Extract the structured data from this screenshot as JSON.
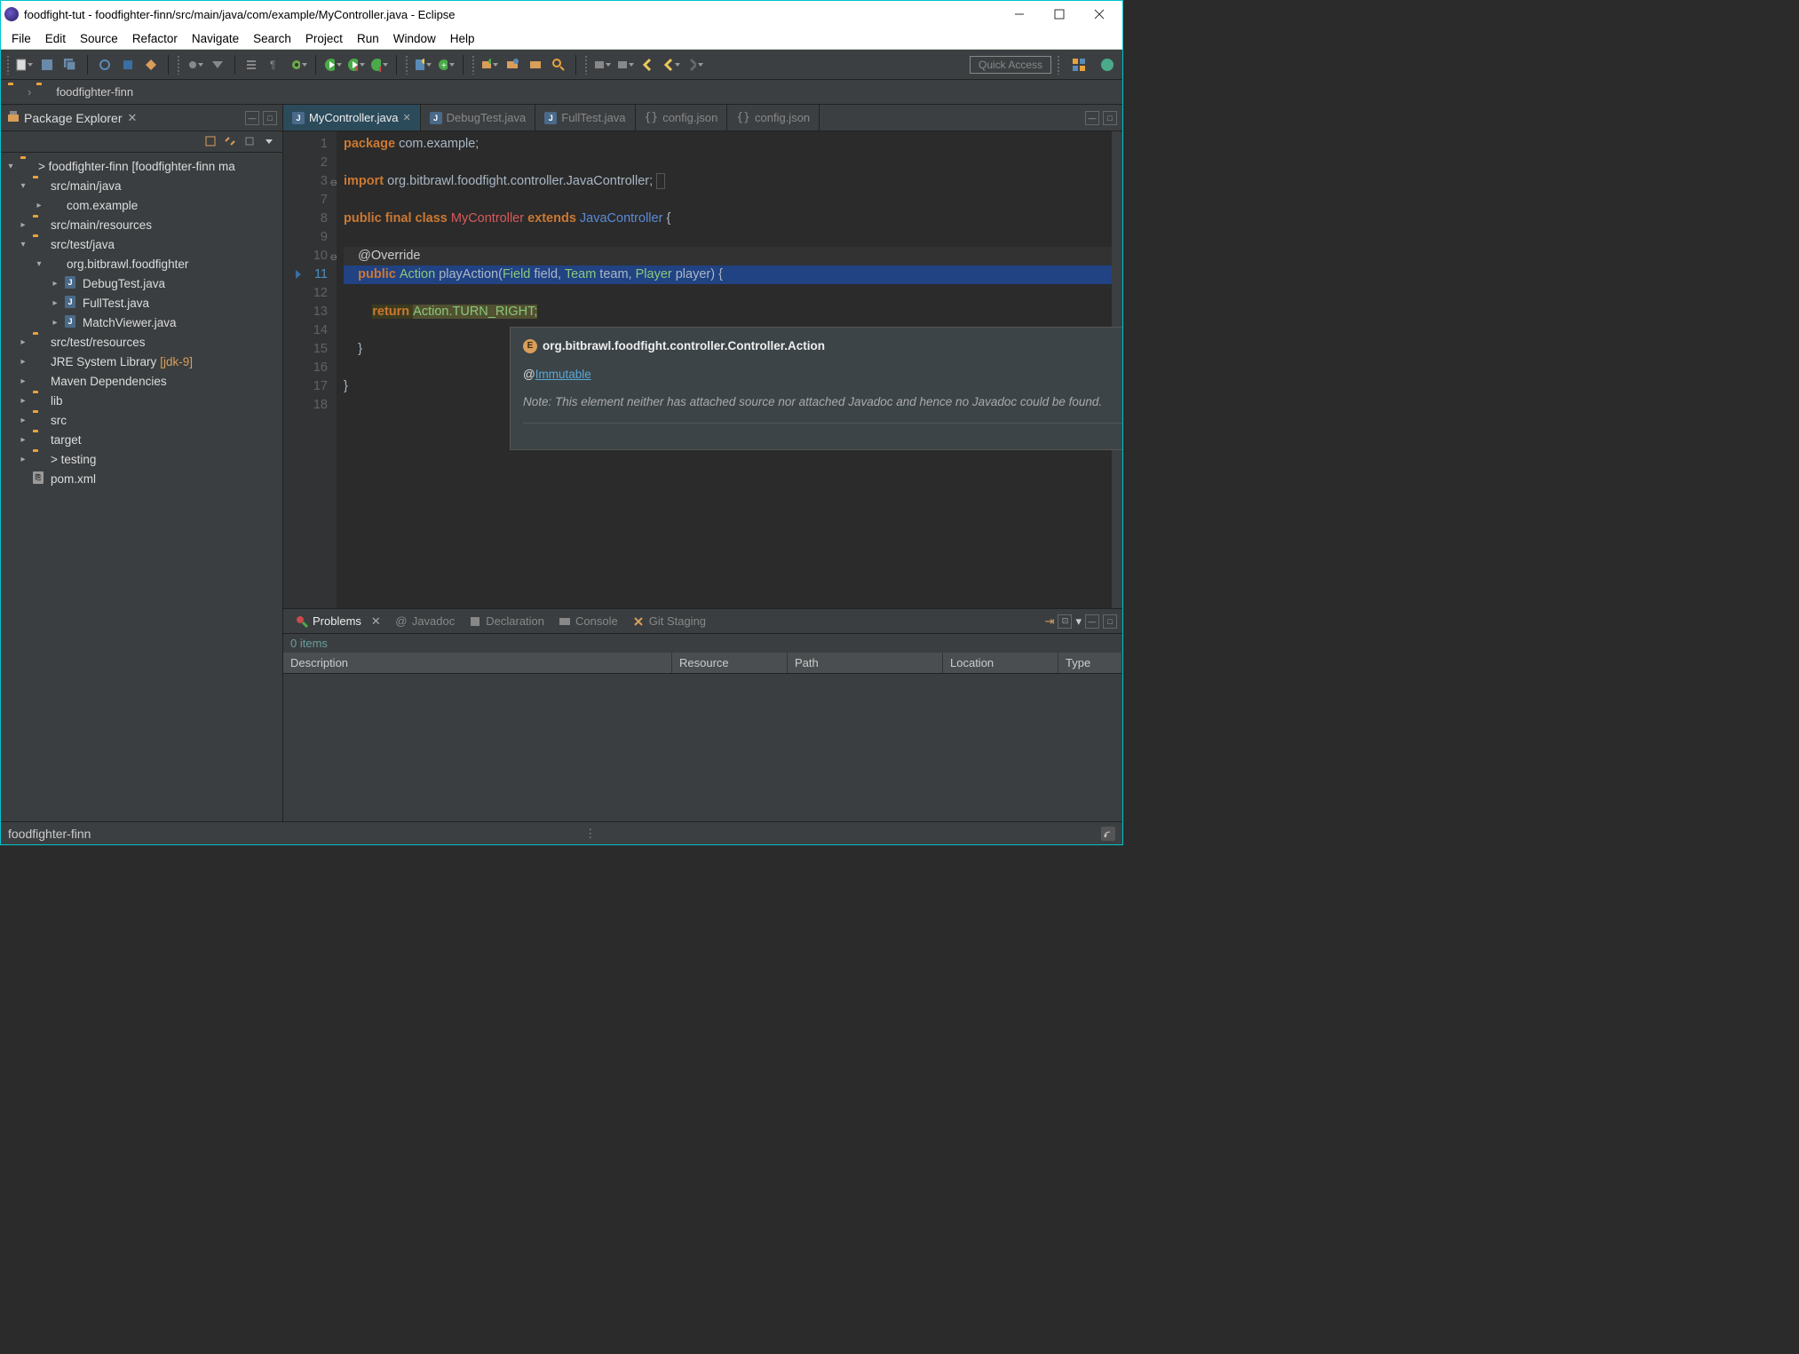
{
  "window": {
    "title": "foodfight-tut - foodfighter-finn/src/main/java/com/example/MyController.java - Eclipse"
  },
  "menubar": [
    "File",
    "Edit",
    "Source",
    "Refactor",
    "Navigate",
    "Search",
    "Project",
    "Run",
    "Window",
    "Help"
  ],
  "quick_access": "Quick Access",
  "breadcrumb": {
    "project": "foodfighter-finn"
  },
  "package_explorer": {
    "title": "Package Explorer",
    "tree": {
      "root": "> foodfighter-finn [foodfighter-finn ma",
      "src_main_java": "src/main/java",
      "com_example": "com.example",
      "src_main_resources": "src/main/resources",
      "src_test_java": "src/test/java",
      "org_bitbrawl": "org.bitbrawl.foodfighter",
      "debugtest": "DebugTest.java",
      "fulltest": "FullTest.java",
      "matchviewer": "MatchViewer.java",
      "src_test_resources": "src/test/resources",
      "jre": "JRE System Library",
      "jre_dec": "[jdk-9]",
      "maven": "Maven Dependencies",
      "lib": "lib",
      "src": "src",
      "target": "target",
      "testing": "> testing",
      "pom": "pom.xml"
    }
  },
  "editor": {
    "tabs": [
      {
        "label": "MyController.java",
        "active": true,
        "type": "java"
      },
      {
        "label": "DebugTest.java",
        "active": false,
        "type": "java"
      },
      {
        "label": "FullTest.java",
        "active": false,
        "type": "java"
      },
      {
        "label": "config.json",
        "active": false,
        "type": "json"
      },
      {
        "label": "config.json",
        "active": false,
        "type": "json"
      }
    ],
    "lines": {
      "l1_kw": "package",
      "l1_rest": " com.example;",
      "l3_kw": "import",
      "l3_rest": " org.bitbrawl.foodfight.controller.JavaController;",
      "l8_kw1": "public final class ",
      "l8_cls": "MyController",
      "l8_kw2": " extends ",
      "l8_sup": "JavaController",
      "l8_brace": " {",
      "l10_ann": "@Override",
      "l11_kw": "public ",
      "l11_ret": "Action",
      "l11_method": " playAction(",
      "l11_t1": "Field",
      "l11_p1": " field, ",
      "l11_t2": "Team",
      "l11_p2": " team, ",
      "l11_t3": "Player",
      "l11_p3": " player) {",
      "l13_kw": "return ",
      "l13_cls": "Action",
      "l13_const": ".TURN_RIGHT;",
      "l14": "",
      "l15": "    }",
      "l16": "",
      "l17": "}",
      "l18": ""
    },
    "line_numbers": [
      1,
      2,
      3,
      7,
      8,
      9,
      10,
      11,
      12,
      13,
      14,
      15,
      16,
      17,
      18
    ]
  },
  "hover": {
    "title": "org.bitbrawl.foodfight.controller.Controller.Action",
    "annotation_prefix": "@",
    "annotation_link": "Immutable",
    "note": "Note: This element neither has attached source nor attached Javadoc and hence no Javadoc could be found."
  },
  "problems": {
    "tabs": [
      {
        "label": "Problems",
        "active": true
      },
      {
        "label": "Javadoc",
        "active": false
      },
      {
        "label": "Declaration",
        "active": false
      },
      {
        "label": "Console",
        "active": false
      },
      {
        "label": "Git Staging",
        "active": false
      }
    ],
    "count": "0 items",
    "columns": [
      "Description",
      "Resource",
      "Path",
      "Location",
      "Type"
    ]
  },
  "statusbar": {
    "text": "foodfighter-finn"
  }
}
